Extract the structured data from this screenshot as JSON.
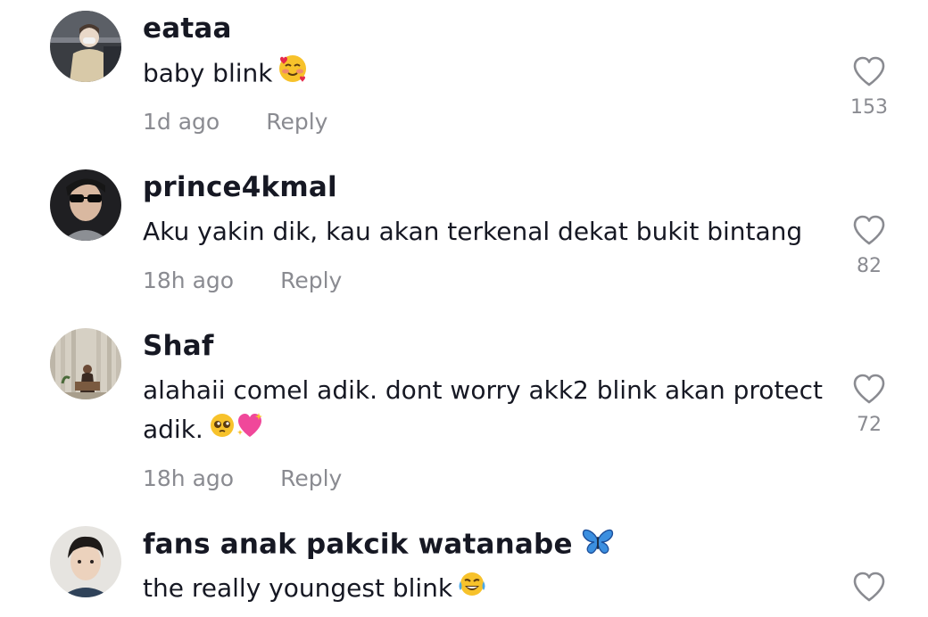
{
  "comments": [
    {
      "username": "eataa",
      "text": "baby blink",
      "emoji": "smiling-face-with-hearts",
      "time": "1d ago",
      "reply_label": "Reply",
      "likes": "153"
    },
    {
      "username": "prince4kmal",
      "text": "Aku yakin dik, kau akan terkenal dekat bukit bintang",
      "time": "18h ago",
      "reply_label": "Reply",
      "likes": "82"
    },
    {
      "username": "Shaf",
      "text": "alahaii comel adik. dont worry akk2 blink akan protect adik.",
      "emoji": "pleading-face sparkling-heart",
      "time": "18h ago",
      "reply_label": "Reply",
      "likes": "72"
    },
    {
      "username": "fans anak pakcik watanabe",
      "username_emoji": "butterfly",
      "text": "the really youngest blink",
      "emoji": "face-with-tears-of-joy"
    }
  ],
  "colors": {
    "text": "#161823",
    "secondary": "#8a8b91",
    "background": "#ffffff"
  }
}
